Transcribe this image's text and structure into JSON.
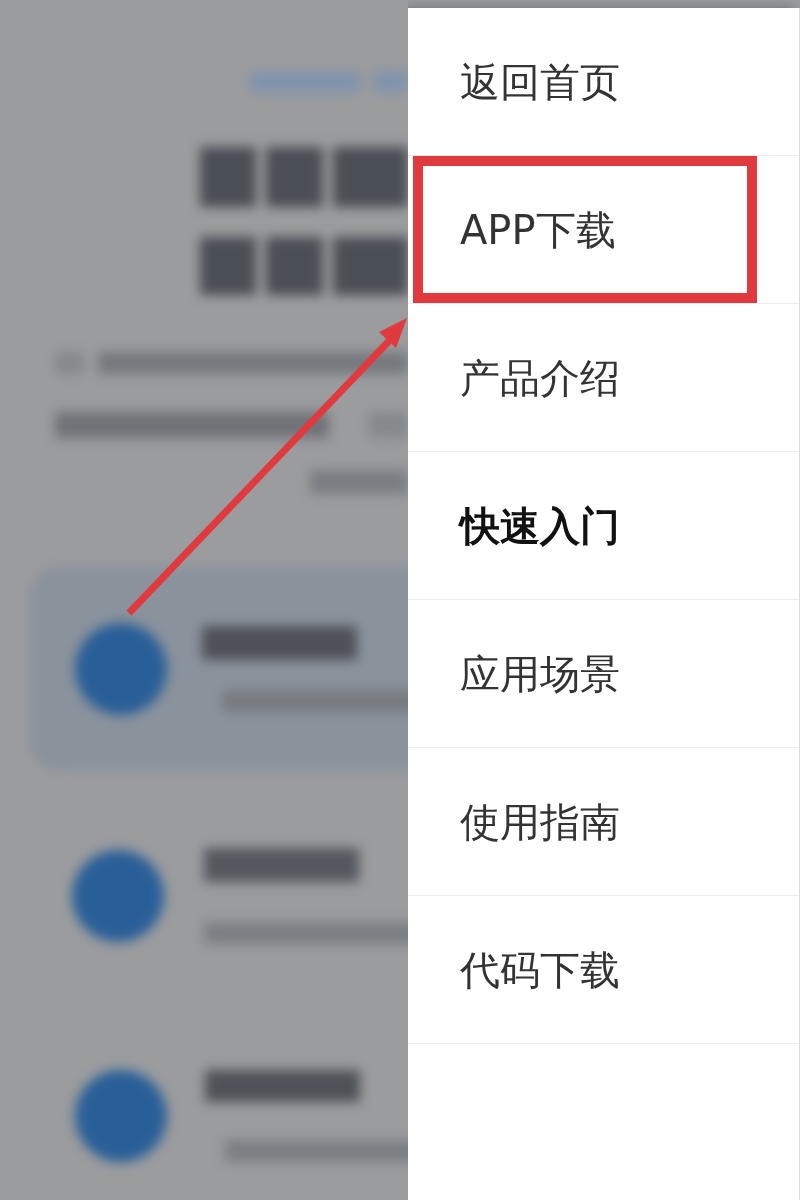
{
  "menu": {
    "items": [
      {
        "label": "返回首页",
        "selected": false,
        "highlighted": false
      },
      {
        "label": "APP下载",
        "selected": false,
        "highlighted": true
      },
      {
        "label": "产品介绍",
        "selected": false,
        "highlighted": false
      },
      {
        "label": "快速入门",
        "selected": true,
        "highlighted": false
      },
      {
        "label": "应用场景",
        "selected": false,
        "highlighted": false
      },
      {
        "label": "使用指南",
        "selected": false,
        "highlighted": false
      },
      {
        "label": "代码下载",
        "selected": false,
        "highlighted": false
      }
    ]
  }
}
